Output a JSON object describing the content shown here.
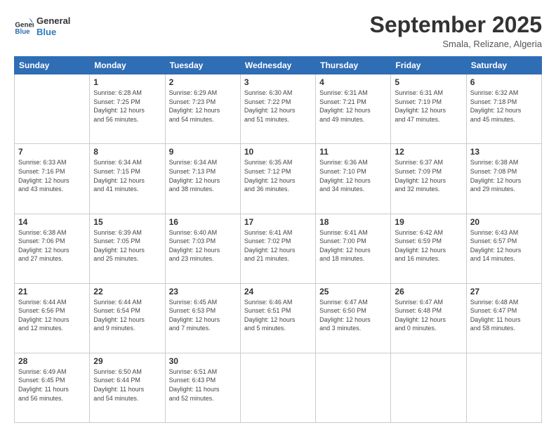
{
  "header": {
    "logo_line1": "General",
    "logo_line2": "Blue",
    "month": "September 2025",
    "location": "Smala, Relizane, Algeria"
  },
  "days_of_week": [
    "Sunday",
    "Monday",
    "Tuesday",
    "Wednesday",
    "Thursday",
    "Friday",
    "Saturday"
  ],
  "weeks": [
    [
      {
        "day": "",
        "info": ""
      },
      {
        "day": "1",
        "info": "Sunrise: 6:28 AM\nSunset: 7:25 PM\nDaylight: 12 hours\nand 56 minutes."
      },
      {
        "day": "2",
        "info": "Sunrise: 6:29 AM\nSunset: 7:23 PM\nDaylight: 12 hours\nand 54 minutes."
      },
      {
        "day": "3",
        "info": "Sunrise: 6:30 AM\nSunset: 7:22 PM\nDaylight: 12 hours\nand 51 minutes."
      },
      {
        "day": "4",
        "info": "Sunrise: 6:31 AM\nSunset: 7:21 PM\nDaylight: 12 hours\nand 49 minutes."
      },
      {
        "day": "5",
        "info": "Sunrise: 6:31 AM\nSunset: 7:19 PM\nDaylight: 12 hours\nand 47 minutes."
      },
      {
        "day": "6",
        "info": "Sunrise: 6:32 AM\nSunset: 7:18 PM\nDaylight: 12 hours\nand 45 minutes."
      }
    ],
    [
      {
        "day": "7",
        "info": "Sunrise: 6:33 AM\nSunset: 7:16 PM\nDaylight: 12 hours\nand 43 minutes."
      },
      {
        "day": "8",
        "info": "Sunrise: 6:34 AM\nSunset: 7:15 PM\nDaylight: 12 hours\nand 41 minutes."
      },
      {
        "day": "9",
        "info": "Sunrise: 6:34 AM\nSunset: 7:13 PM\nDaylight: 12 hours\nand 38 minutes."
      },
      {
        "day": "10",
        "info": "Sunrise: 6:35 AM\nSunset: 7:12 PM\nDaylight: 12 hours\nand 36 minutes."
      },
      {
        "day": "11",
        "info": "Sunrise: 6:36 AM\nSunset: 7:10 PM\nDaylight: 12 hours\nand 34 minutes."
      },
      {
        "day": "12",
        "info": "Sunrise: 6:37 AM\nSunset: 7:09 PM\nDaylight: 12 hours\nand 32 minutes."
      },
      {
        "day": "13",
        "info": "Sunrise: 6:38 AM\nSunset: 7:08 PM\nDaylight: 12 hours\nand 29 minutes."
      }
    ],
    [
      {
        "day": "14",
        "info": "Sunrise: 6:38 AM\nSunset: 7:06 PM\nDaylight: 12 hours\nand 27 minutes."
      },
      {
        "day": "15",
        "info": "Sunrise: 6:39 AM\nSunset: 7:05 PM\nDaylight: 12 hours\nand 25 minutes."
      },
      {
        "day": "16",
        "info": "Sunrise: 6:40 AM\nSunset: 7:03 PM\nDaylight: 12 hours\nand 23 minutes."
      },
      {
        "day": "17",
        "info": "Sunrise: 6:41 AM\nSunset: 7:02 PM\nDaylight: 12 hours\nand 21 minutes."
      },
      {
        "day": "18",
        "info": "Sunrise: 6:41 AM\nSunset: 7:00 PM\nDaylight: 12 hours\nand 18 minutes."
      },
      {
        "day": "19",
        "info": "Sunrise: 6:42 AM\nSunset: 6:59 PM\nDaylight: 12 hours\nand 16 minutes."
      },
      {
        "day": "20",
        "info": "Sunrise: 6:43 AM\nSunset: 6:57 PM\nDaylight: 12 hours\nand 14 minutes."
      }
    ],
    [
      {
        "day": "21",
        "info": "Sunrise: 6:44 AM\nSunset: 6:56 PM\nDaylight: 12 hours\nand 12 minutes."
      },
      {
        "day": "22",
        "info": "Sunrise: 6:44 AM\nSunset: 6:54 PM\nDaylight: 12 hours\nand 9 minutes."
      },
      {
        "day": "23",
        "info": "Sunrise: 6:45 AM\nSunset: 6:53 PM\nDaylight: 12 hours\nand 7 minutes."
      },
      {
        "day": "24",
        "info": "Sunrise: 6:46 AM\nSunset: 6:51 PM\nDaylight: 12 hours\nand 5 minutes."
      },
      {
        "day": "25",
        "info": "Sunrise: 6:47 AM\nSunset: 6:50 PM\nDaylight: 12 hours\nand 3 minutes."
      },
      {
        "day": "26",
        "info": "Sunrise: 6:47 AM\nSunset: 6:48 PM\nDaylight: 12 hours\nand 0 minutes."
      },
      {
        "day": "27",
        "info": "Sunrise: 6:48 AM\nSunset: 6:47 PM\nDaylight: 11 hours\nand 58 minutes."
      }
    ],
    [
      {
        "day": "28",
        "info": "Sunrise: 6:49 AM\nSunset: 6:45 PM\nDaylight: 11 hours\nand 56 minutes."
      },
      {
        "day": "29",
        "info": "Sunrise: 6:50 AM\nSunset: 6:44 PM\nDaylight: 11 hours\nand 54 minutes."
      },
      {
        "day": "30",
        "info": "Sunrise: 6:51 AM\nSunset: 6:43 PM\nDaylight: 11 hours\nand 52 minutes."
      },
      {
        "day": "",
        "info": ""
      },
      {
        "day": "",
        "info": ""
      },
      {
        "day": "",
        "info": ""
      },
      {
        "day": "",
        "info": ""
      }
    ]
  ]
}
